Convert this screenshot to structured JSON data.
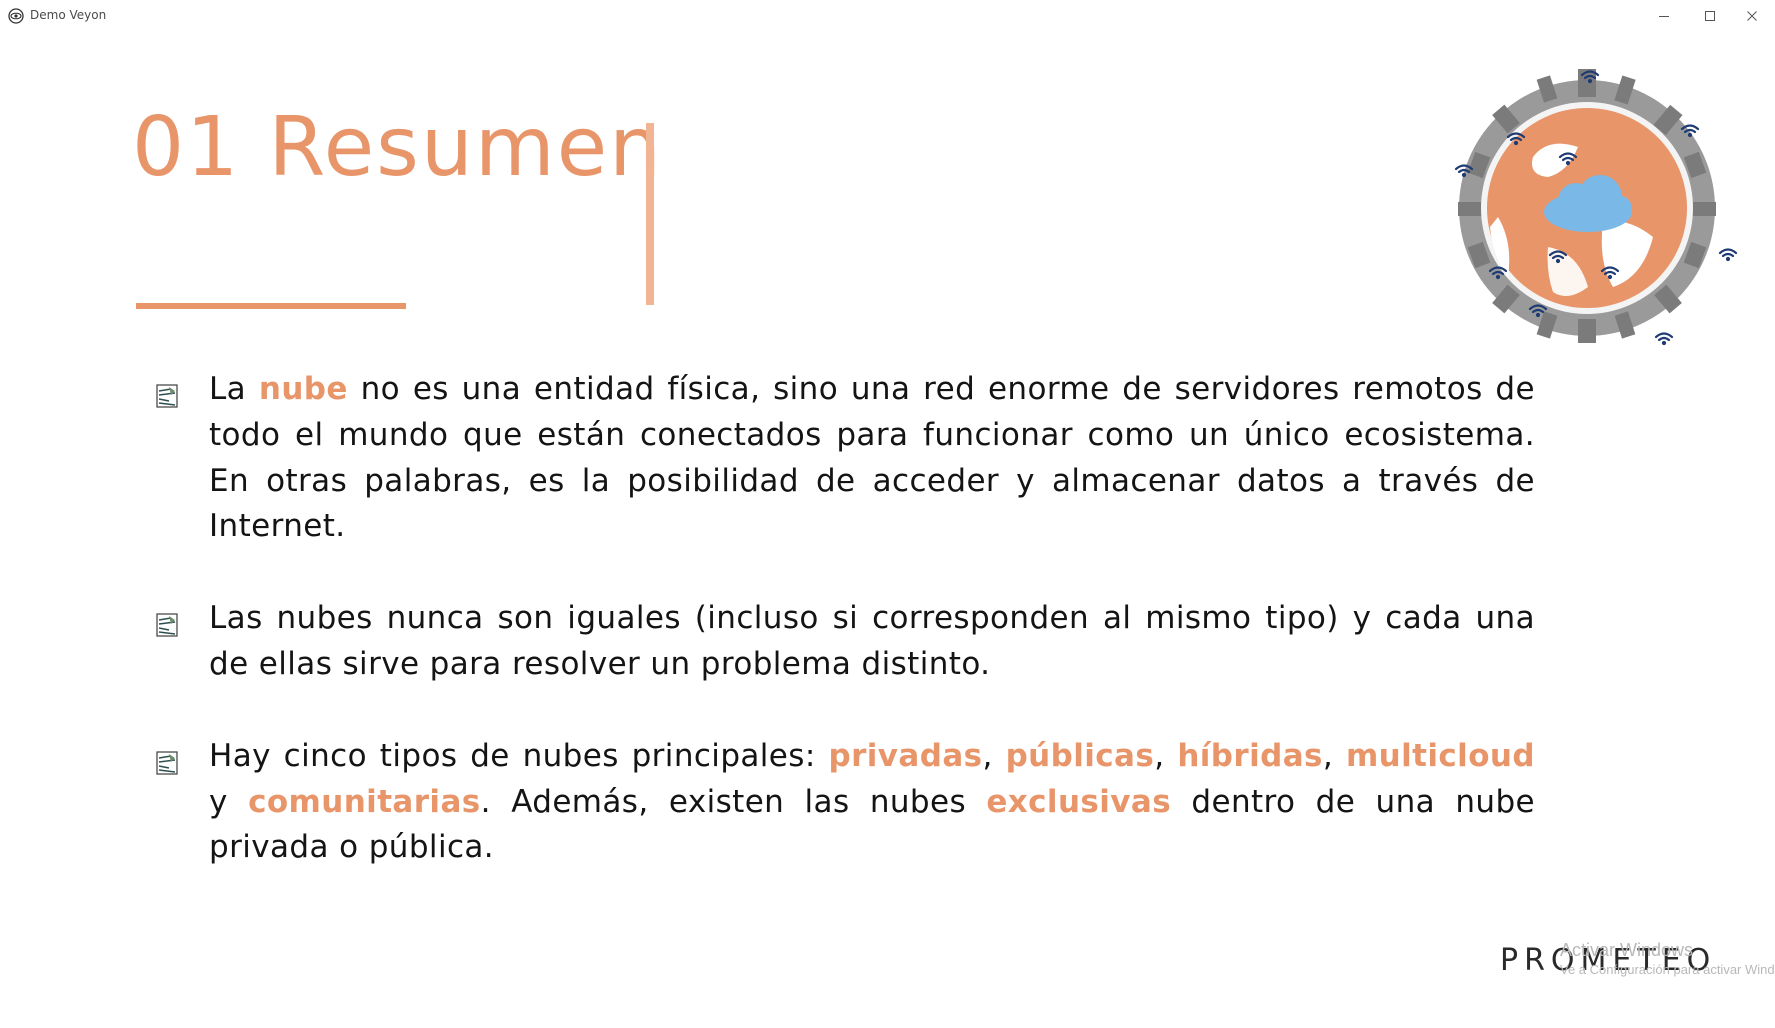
{
  "window": {
    "title": "Demo Veyon",
    "app_icon": "eye-icon",
    "controls": {
      "minimize": "minimize-icon",
      "maximize": "maximize-icon",
      "close": "close-icon"
    }
  },
  "slide": {
    "heading": "01 Resumen",
    "accent_color": "#e8956a",
    "bullet_icon": "bullet-marker-icon",
    "bullets": [
      {
        "segments": [
          {
            "text": "La ",
            "highlight": false
          },
          {
            "text": "nube",
            "highlight": true
          },
          {
            "text": " no es una entidad física, sino una red enorme de servidores remotos de todo el mundo que están conectados para funcionar como un único ecosistema. En otras palabras, es la posibilidad de acceder y almacenar datos a través de Internet.",
            "highlight": false
          }
        ]
      },
      {
        "segments": [
          {
            "text": "Las nubes nunca son iguales (incluso si corresponden al mismo tipo) y cada una de ellas sirve para resolver un problema distinto.",
            "highlight": false
          }
        ]
      },
      {
        "segments": [
          {
            "text": "Hay cinco tipos de nubes principales: ",
            "highlight": false
          },
          {
            "text": "privadas",
            "highlight": true
          },
          {
            "text": ", ",
            "highlight": false
          },
          {
            "text": "públicas",
            "highlight": true
          },
          {
            "text": ", ",
            "highlight": false
          },
          {
            "text": "híbridas",
            "highlight": true
          },
          {
            "text": ", ",
            "highlight": false
          },
          {
            "text": "multicloud",
            "highlight": true
          },
          {
            "text": " y ",
            "highlight": false
          },
          {
            "text": "comunitarias",
            "highlight": true
          },
          {
            "text": ". Además, existen las nubes ",
            "highlight": false
          },
          {
            "text": "exclusivas",
            "highlight": true
          },
          {
            "text": " dentro de una nube privada o pública.",
            "highlight": false
          }
        ]
      }
    ],
    "illustration": "globe-cloud-icon",
    "logo_text": "PROMETEO"
  },
  "watermark": {
    "title": "Activar Windows",
    "subtitle": "Ve a Configuración para activar Windows."
  }
}
